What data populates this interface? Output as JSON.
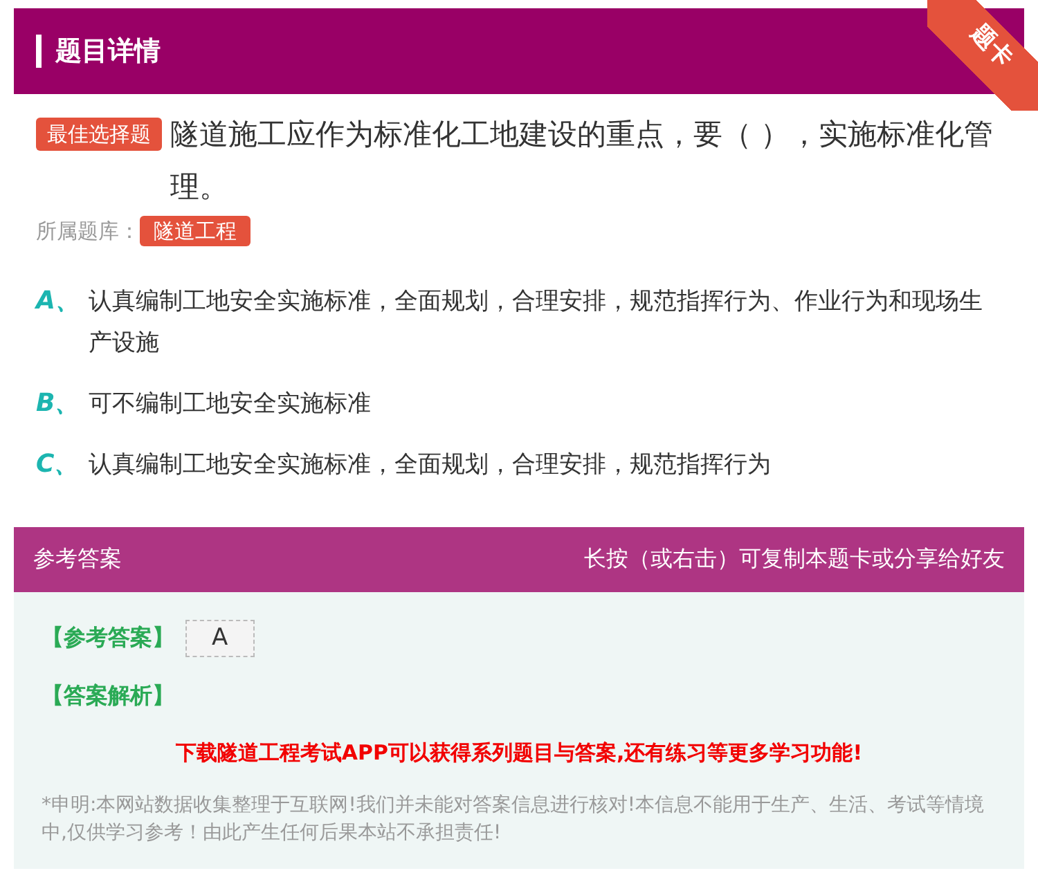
{
  "header": {
    "title": "题目详情",
    "ribbon": "题卡"
  },
  "question": {
    "type_badge": "最佳选择题",
    "text": "隧道施工应作为标准化工地建设的重点，要（ ），实施标准化管理。",
    "bank_label": "所属题库：",
    "bank_tag": "隧道工程"
  },
  "options": [
    {
      "letter": "A、",
      "text": "认真编制工地安全实施标准，全面规划，合理安排，规范指挥行为、作业行为和现场生产设施"
    },
    {
      "letter": "B、",
      "text": "可不编制工地安全实施标准"
    },
    {
      "letter": "C、",
      "text": "认真编制工地安全实施标准，全面规划，合理安排，规范指挥行为"
    }
  ],
  "answer_panel": {
    "title": "参考答案",
    "hint": "长按（或右击）可复制本题卡或分享给好友",
    "answer_label": "【参考答案】",
    "answer": "A",
    "analysis_label": "【答案解析】",
    "promo": "下载隧道工程考试APP可以获得系列题目与答案,还有练习等更多学习功能!",
    "disclaimer": "*申明:本网站数据收集整理于互联网!我们并未能对答案信息进行核对!本信息不能用于生产、生活、考试等情境中,仅供学习参考！由此产生任何后果本站不承担责任!"
  }
}
